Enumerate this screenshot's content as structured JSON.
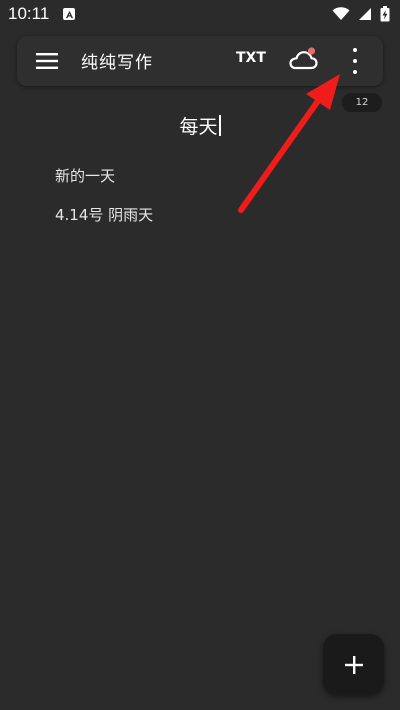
{
  "status_bar": {
    "time": "10:11",
    "icons": [
      "app-a-icon",
      "wifi-icon",
      "signal-icon",
      "battery-charging-icon"
    ]
  },
  "toolbar": {
    "app_title": "纯纯写作",
    "txt_label": "TXT",
    "cloud_icon": "cloud-icon",
    "cloud_badge_color": "#e86e6e",
    "menu_icon": "hamburger-menu-icon",
    "more_icon": "more-vertical-icon"
  },
  "document": {
    "word_count": "12",
    "title": "每天",
    "lines": [
      "新的一天",
      "4.14号 阴雨天"
    ]
  },
  "annotation": {
    "arrow_color": "#f01c1c"
  },
  "fab": {
    "icon": "plus-icon"
  },
  "colors": {
    "background": "#2b2b2b",
    "toolbar": "#2f2f2f",
    "fab": "#1a1a1a"
  }
}
